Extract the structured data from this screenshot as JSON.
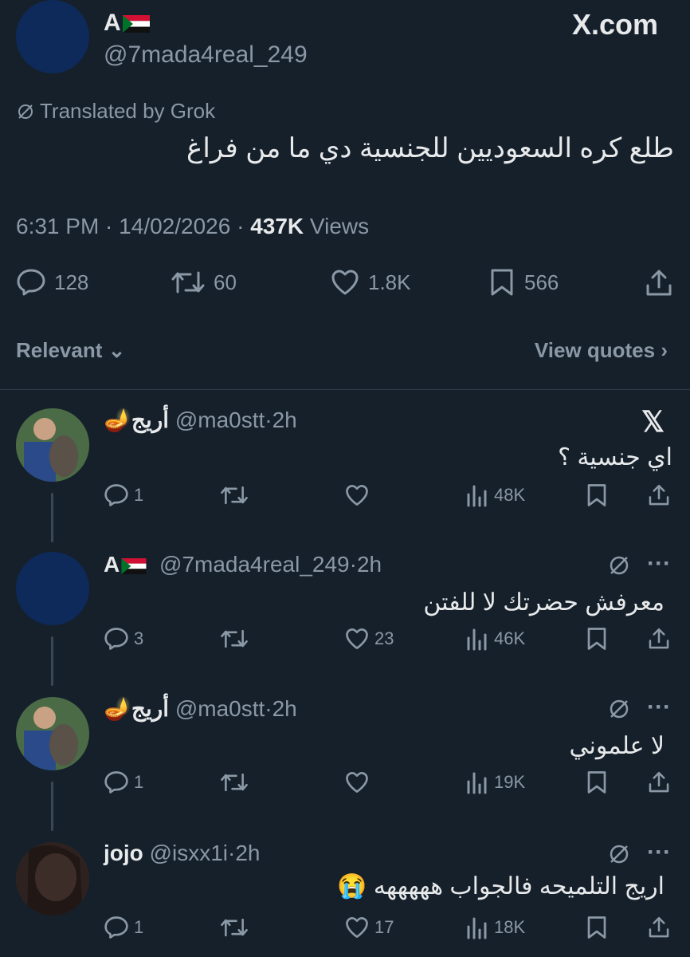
{
  "brand": {
    "site": "X.com"
  },
  "main_tweet": {
    "display_name": "A",
    "handle": "@7mada4real_249",
    "translated_label": "Translated by Grok",
    "text": "طلع كره السعوديين للجنسية دي ما من فراغ",
    "time": "6:31 PM",
    "date": "14/02/2026",
    "views_count": "437K",
    "views_label": "Views",
    "replies": "128",
    "retweets": "60",
    "likes": "1.8K",
    "bookmarks": "566"
  },
  "sort": {
    "label": "Relevant",
    "view_quotes": "View quotes"
  },
  "replies": [
    {
      "name": "أريج",
      "handle": "@ma0stt",
      "time": "2h",
      "text": "اي جنسية ؟",
      "replies": "1",
      "retweets": "",
      "likes": "",
      "views": "48K"
    },
    {
      "name": "A",
      "handle": "@7mada4real_249",
      "time": "2h",
      "text": "معرفش حضرتك لا للفتن",
      "replies": "3",
      "retweets": "",
      "likes": "23",
      "views": "46K"
    },
    {
      "name": "أريج",
      "handle": "@ma0stt",
      "time": "2h",
      "text": "لا علموني",
      "replies": "1",
      "retweets": "",
      "likes": "",
      "views": "19K"
    },
    {
      "name": "jojo",
      "handle": "@isxx1i",
      "time": "2h",
      "text": "اريج التلميحه فالجواب هههههه 😭",
      "replies": "1",
      "retweets": "",
      "likes": "17",
      "views": "18K"
    }
  ],
  "colors": {
    "background": "#15202b",
    "text": "#e7e9ea",
    "muted": "#8b98a5",
    "divider": "#2f3b47"
  },
  "icons": [
    "reply-icon",
    "retweet-icon",
    "like-icon",
    "bookmark-icon",
    "share-icon",
    "views-icon",
    "x-logo-icon",
    "grok-icon",
    "more-icon",
    "lamp-emoji",
    "sudan-flag"
  ]
}
